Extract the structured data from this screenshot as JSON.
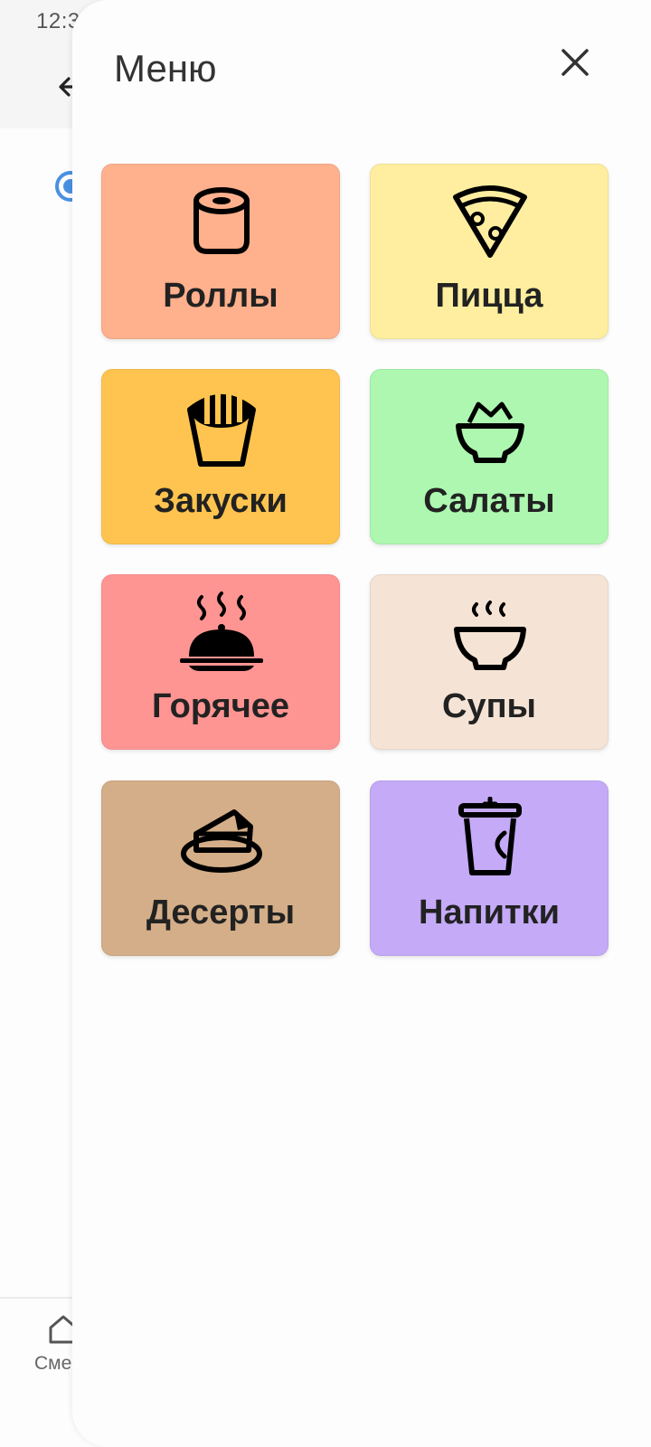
{
  "background": {
    "status_time": "12:3",
    "nav_label": "Сме"
  },
  "sheet": {
    "title": "Меню"
  },
  "categories": [
    {
      "label": "Роллы",
      "icon": "roll-icon",
      "color": "#ffb08c"
    },
    {
      "label": "Пицца",
      "icon": "pizza-icon",
      "color": "#ffee9f"
    },
    {
      "label": "Закуски",
      "icon": "fries-icon",
      "color": "#ffc44f"
    },
    {
      "label": "Салаты",
      "icon": "salad-icon",
      "color": "#adf7b0"
    },
    {
      "label": "Горячее",
      "icon": "cloche-icon",
      "color": "#ff9593"
    },
    {
      "label": "Супы",
      "icon": "soup-icon",
      "color": "#f5e4d5"
    },
    {
      "label": "Десерты",
      "icon": "cake-icon",
      "color": "#d4ae88"
    },
    {
      "label": "Напитки",
      "icon": "drink-icon",
      "color": "#c4aaf7"
    }
  ]
}
